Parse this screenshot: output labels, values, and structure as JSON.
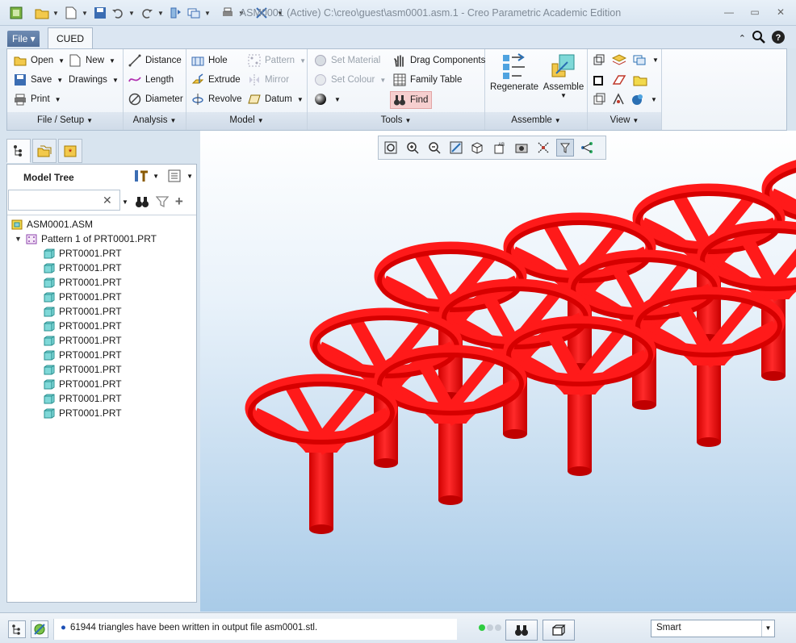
{
  "window": {
    "title": "ASM0001 (Active) C:\\creo\\guest\\asm0001.asm.1 - Creo Parametric Academic Edition"
  },
  "tabs": {
    "file": "File",
    "cued": "CUED"
  },
  "ribbon": {
    "file_setup": {
      "open": "Open",
      "new": "New",
      "save": "Save",
      "drawings": "Drawings",
      "print": "Print",
      "footer": "File / Setup"
    },
    "analysis": {
      "distance": "Distance",
      "length": "Length",
      "diameter": "Diameter",
      "footer": "Analysis"
    },
    "model": {
      "hole": "Hole",
      "pattern": "Pattern",
      "extrude": "Extrude",
      "mirror": "Mirror",
      "revolve": "Revolve",
      "datum": "Datum",
      "footer": "Model"
    },
    "tools": {
      "set_material": "Set Material",
      "set_colour": "Set Colour",
      "drag_components": "Drag Components",
      "family_table": "Family Table",
      "find": "Find",
      "footer": "Tools"
    },
    "assemble": {
      "regenerate": "Regenerate",
      "assemble": "Assemble",
      "footer": "Assemble"
    },
    "view": {
      "footer": "View"
    }
  },
  "model_tree": {
    "title": "Model Tree",
    "search_placeholder": "",
    "root": "ASM0001.ASM",
    "pattern": "Pattern 1 of PRT0001.PRT",
    "parts": [
      "PRT0001.PRT",
      "PRT0001.PRT",
      "PRT0001.PRT",
      "PRT0001.PRT",
      "PRT0001.PRT",
      "PRT0001.PRT",
      "PRT0001.PRT",
      "PRT0001.PRT",
      "PRT0001.PRT",
      "PRT0001.PRT",
      "PRT0001.PRT",
      "PRT0001.PRT"
    ]
  },
  "status": {
    "message": "61944 triangles have been written in output file asm0001.stl.",
    "filter": "Smart"
  },
  "colors": {
    "model": "#ff1a1a",
    "accent": "#4f6d98"
  }
}
